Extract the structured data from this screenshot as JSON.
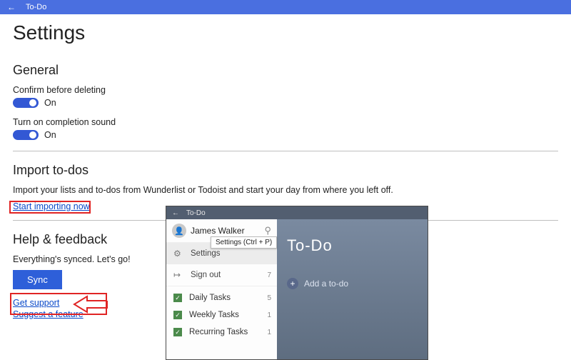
{
  "titlebar": {
    "app": "To-Do"
  },
  "page_title": "Settings",
  "general": {
    "heading": "General",
    "confirm_delete": {
      "label": "Confirm before deleting",
      "state": "On"
    },
    "completion_sound": {
      "label": "Turn on completion sound",
      "state": "On"
    }
  },
  "import": {
    "heading": "Import to-dos",
    "desc": "Import your lists and to-dos from Wunderlist or Todoist and start your day from where you left off.",
    "link": "Start importing now"
  },
  "help": {
    "heading": "Help & feedback",
    "status": "Everything's synced. Let's go!",
    "sync_label": "Sync",
    "get_support": "Get support",
    "suggest": "Suggest a feature"
  },
  "inset": {
    "app": "To-Do",
    "user": "James Walker",
    "tooltip": "Settings (Ctrl + P)",
    "menu": {
      "settings": {
        "label": "Settings"
      },
      "signout": {
        "label": "Sign out",
        "count": "7"
      }
    },
    "lists": [
      {
        "label": "Daily Tasks",
        "count": "5"
      },
      {
        "label": "Weekly Tasks",
        "count": "1"
      },
      {
        "label": "Recurring Tasks",
        "count": "1"
      }
    ],
    "main_title": "To-Do",
    "add_label": "Add a to-do"
  }
}
